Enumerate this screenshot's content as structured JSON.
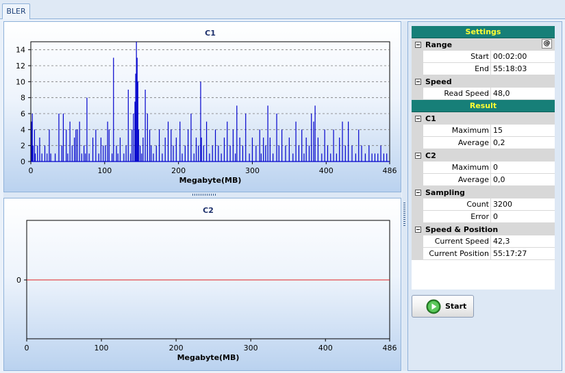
{
  "tab": {
    "label": "BLER"
  },
  "charts": [
    {
      "id": "c1",
      "type": "bar",
      "title": "C1",
      "xlabel": "Megabyte(MB)",
      "ylabel": "",
      "xlim": [
        0,
        486
      ],
      "ylim": [
        0,
        15
      ],
      "xticks": [
        0,
        100,
        200,
        300,
        400,
        486
      ],
      "yticks": [
        0,
        2,
        4,
        6,
        8,
        10,
        12,
        14
      ],
      "grid": "horizontal-dashed",
      "series_color": "#0000cc",
      "x": [
        1,
        2,
        3,
        5,
        6,
        9,
        12,
        15,
        19,
        22,
        25,
        27,
        33,
        38,
        42,
        44,
        48,
        50,
        53,
        56,
        59,
        61,
        63,
        66,
        69,
        72,
        74,
        76,
        79,
        84,
        88,
        92,
        95,
        98,
        101,
        104,
        106,
        110,
        112,
        116,
        118,
        121,
        126,
        129,
        132,
        135,
        137,
        139,
        141,
        142,
        143,
        144,
        145,
        146,
        148,
        150,
        152,
        155,
        158,
        161,
        163,
        166,
        170,
        174,
        178,
        182,
        186,
        190,
        193,
        197,
        202,
        205,
        209,
        213,
        217,
        221,
        224,
        227,
        230,
        231,
        234,
        238,
        242,
        246,
        250,
        254,
        258,
        262,
        266,
        270,
        274,
        277,
        279,
        283,
        287,
        291,
        296,
        300,
        305,
        310,
        312,
        315,
        318,
        321,
        324,
        328,
        333,
        336,
        340,
        345,
        350,
        355,
        359,
        363,
        367,
        370,
        373,
        377,
        380,
        383,
        385,
        389,
        394,
        398,
        402,
        406,
        410,
        414,
        418,
        422,
        426,
        430,
        435,
        440,
        444,
        448,
        453,
        458,
        462,
        466,
        470,
        474,
        478,
        482
      ],
      "values": [
        5,
        6,
        2,
        4,
        1,
        2,
        3,
        1,
        2,
        1,
        4,
        1,
        1,
        6,
        2,
        6,
        4,
        1,
        5,
        2,
        3,
        4,
        4,
        5,
        1,
        2,
        1,
        8,
        1,
        3,
        4,
        1,
        3,
        2,
        2,
        5,
        4,
        1,
        13,
        2,
        1,
        3,
        1,
        2,
        9,
        1,
        4,
        6,
        7.5,
        11,
        15,
        13,
        10,
        4,
        2,
        1,
        3,
        9,
        6,
        4,
        2,
        1,
        2,
        4,
        1,
        3,
        5,
        4,
        2,
        3,
        5,
        1,
        2,
        4,
        6,
        1,
        3,
        2,
        10,
        3,
        2,
        5,
        1,
        2,
        4,
        2,
        1,
        3,
        5,
        2,
        4,
        1,
        7,
        3,
        2,
        6,
        1,
        3,
        2,
        4,
        1,
        3,
        2,
        7,
        3,
        1,
        6,
        2,
        4,
        2,
        3,
        1,
        5,
        2,
        4,
        1,
        3,
        2,
        6,
        5,
        7,
        3,
        1,
        4,
        2,
        1,
        4,
        1,
        3,
        5,
        2,
        5,
        2,
        1,
        4,
        2,
        1,
        2,
        1,
        1,
        1,
        2,
        1,
        1
      ]
    },
    {
      "id": "c2",
      "type": "line",
      "title": "C2",
      "xlabel": "Megabyte(MB)",
      "ylabel": "",
      "xlim": [
        0,
        486
      ],
      "xticks": [
        0,
        100,
        200,
        300,
        400,
        486
      ],
      "yticks": [
        0
      ],
      "series_color": "#e02020",
      "x": [
        0,
        486
      ],
      "values": [
        0,
        0
      ]
    }
  ],
  "grid": {
    "settings_header": "Settings",
    "result_header": "Result",
    "range": {
      "label": "Range",
      "at_button": "@",
      "start_label": "Start",
      "start_value": "00:02:00",
      "end_label": "End",
      "end_value": "55:18:03"
    },
    "speed": {
      "label": "Speed",
      "read_speed_label": "Read Speed",
      "read_speed_value": "48,0"
    },
    "c1": {
      "label": "C1",
      "maximum_label": "Maximum",
      "maximum_value": "15",
      "average_label": "Average",
      "average_value": "0,2"
    },
    "c2": {
      "label": "C2",
      "maximum_label": "Maximum",
      "maximum_value": "0",
      "average_label": "Average",
      "average_value": "0,0"
    },
    "sampling": {
      "label": "Sampling",
      "count_label": "Count",
      "count_value": "3200",
      "error_label": "Error",
      "error_value": "0"
    },
    "speed_position": {
      "label": "Speed & Position",
      "current_speed_label": "Current Speed",
      "current_speed_value": "42,3",
      "current_position_label": "Current Position",
      "current_position_value": "55:17:27"
    }
  },
  "start_button": {
    "label": "Start",
    "icon": "play-icon"
  }
}
